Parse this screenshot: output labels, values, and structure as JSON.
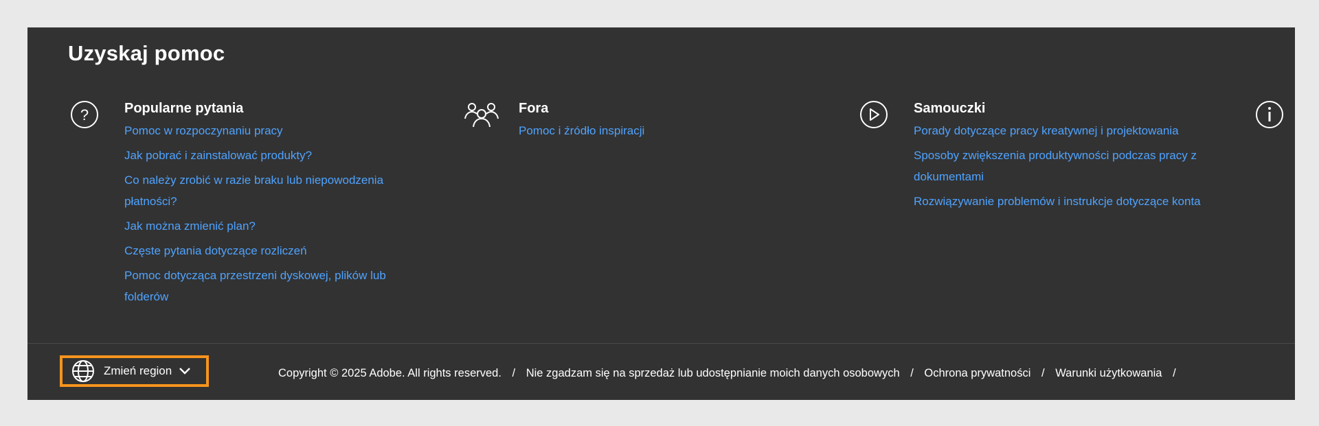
{
  "help": {
    "title": "Uzyskaj pomoc",
    "columns": [
      {
        "icon": "question-circle-icon",
        "heading": "Popularne pytania",
        "links": [
          "Pomoc w rozpoczynaniu pracy",
          "Jak pobrać i zainstalować produkty?",
          "Co należy zrobić w razie braku lub niepowodzenia płatności?",
          "Jak można zmienić plan?",
          "Częste pytania dotyczące rozliczeń",
          "Pomoc dotycząca przestrzeni dyskowej, plików lub folderów"
        ]
      },
      {
        "icon": "community-people-icon",
        "heading": "Fora",
        "links": [
          "Pomoc i źródło inspiracji"
        ]
      },
      {
        "icon": "play-circle-icon",
        "heading": "Samouczki",
        "links": [
          "Porady dotyczące pracy kreatywnej i projektowania",
          "Sposoby zwiększenia produktywności podczas pracy z dokumentami",
          "Rozwiązywanie problemów i instrukcje dotyczące konta"
        ]
      },
      {
        "icon": "info-circle-icon"
      }
    ]
  },
  "footer": {
    "region_label": "Zmień region",
    "copyright": "Copyright © 2025 Adobe. All rights reserved.",
    "links": [
      "Nie zgadzam się na sprzedaż lub udostępnianie moich danych osobowych",
      "Ochrona prywatności",
      "Warunki użytkowania"
    ],
    "separator": "/"
  },
  "colors": {
    "panel_bg": "#323232",
    "page_bg": "#e9e9e9",
    "link": "#4fa3ff",
    "highlight_border": "#f7941d"
  }
}
